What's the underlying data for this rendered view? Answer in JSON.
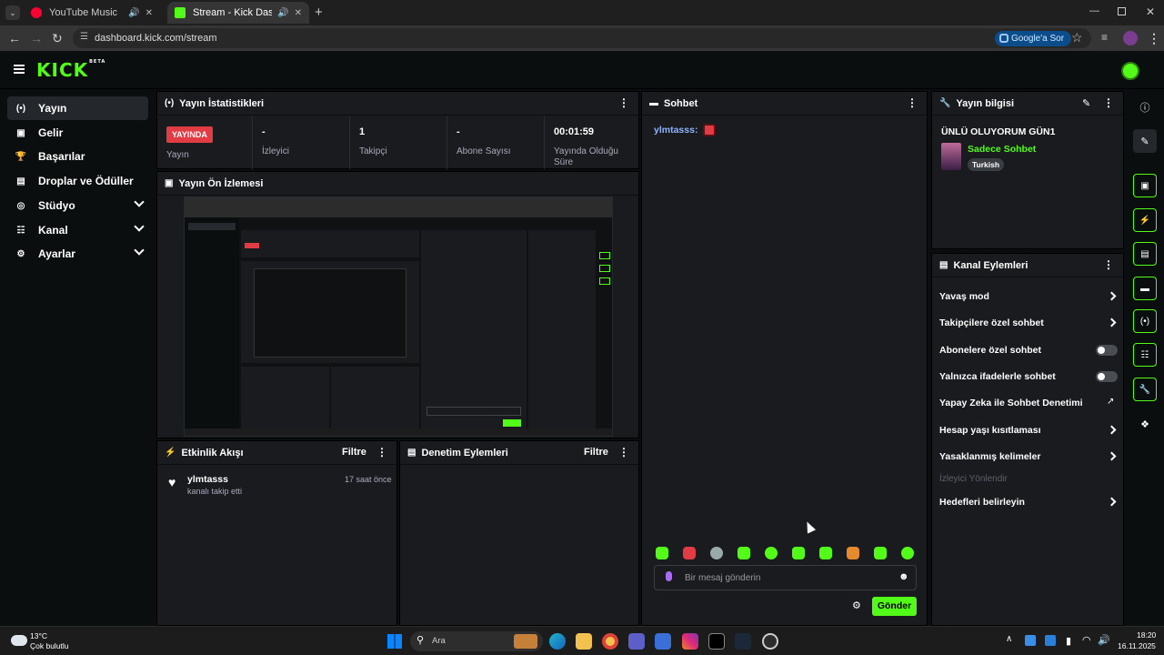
{
  "browser": {
    "tabs": [
      {
        "title": "YouTube Music",
        "active": false
      },
      {
        "title": "Stream - Kick Dashboard",
        "active": true
      }
    ],
    "new_tab_symbol": "+",
    "url": "dashboard.kick.com/stream",
    "google_sor": "Google'a Sor"
  },
  "app": {
    "logo": "KICK",
    "logo_badge": "BETA"
  },
  "sidebar": {
    "items": [
      {
        "label": "Yayın",
        "icon": "broadcast-icon",
        "active": true
      },
      {
        "label": "Gelir",
        "icon": "money-icon"
      },
      {
        "label": "Başarılar",
        "icon": "trophy-icon"
      },
      {
        "label": "Droplar ve Ödüller",
        "icon": "gift-icon"
      },
      {
        "label": "Stüdyo",
        "icon": "studio-icon",
        "expandable": true
      },
      {
        "label": "Kanal",
        "icon": "channel-icon",
        "expandable": true
      },
      {
        "label": "Ayarlar",
        "icon": "gear-icon",
        "expandable": true
      }
    ]
  },
  "stats": {
    "title": "Yayın İstatistikleri",
    "live_badge": "YAYINDA",
    "live_label": "Yayın",
    "cells": [
      {
        "value": "-",
        "label": "İzleyici"
      },
      {
        "value": "1",
        "label": "Takipçi"
      },
      {
        "value": "-",
        "label": "Abone Sayısı"
      },
      {
        "value": "00:01:59",
        "label": "Yayında Olduğu Süre"
      }
    ]
  },
  "preview": {
    "title": "Yayın Ön İzlemesi"
  },
  "activity": {
    "title": "Etkinlik Akışı",
    "filter": "Filtre",
    "events": [
      {
        "user": "ylmtasss",
        "time": "17 saat önce",
        "text": "kanalı takip etti"
      }
    ]
  },
  "moderation": {
    "title": "Denetim Eylemleri",
    "filter": "Filtre"
  },
  "chat": {
    "title": "Sohbet",
    "messages": [
      {
        "user": "ylmtasss:"
      }
    ],
    "input_placeholder": "Bir mesaj gönderin",
    "send_label": "Gönder"
  },
  "stream_info": {
    "title": "Yayın bilgisi",
    "stream_title": "ÜNLÜ OLUYORUM GÜN1",
    "category": "Sadece Sohbet",
    "tag": "Turkish"
  },
  "channel_actions": {
    "title": "Kanal Eylemleri",
    "rows": [
      {
        "label": "Yavaş mod",
        "control": "chevron"
      },
      {
        "label": "Takipçilere özel sohbet",
        "control": "chevron"
      },
      {
        "label": "Abonelere özel sohbet",
        "control": "toggle"
      },
      {
        "label": "Yalnızca ifadelerle sohbet",
        "control": "toggle"
      },
      {
        "label": "Yapay Zeka ile Sohbet Denetimi",
        "control": "external"
      },
      {
        "label": "Hesap yaşı kısıtlaması",
        "control": "chevron"
      },
      {
        "label": "Yasaklanmış kelimeler",
        "control": "chevron"
      },
      {
        "label": "İzleyici Yönlendir",
        "control": "disabled"
      },
      {
        "label": "Hedefleri belirleyin",
        "control": "chevron"
      }
    ]
  },
  "colors": {
    "brand": "#53fc18",
    "panel": "#191b1f",
    "live": "#e13b44"
  },
  "taskbar": {
    "weather_temp": "13°C",
    "weather_desc": "Çok bulutlu",
    "search": "Ara",
    "time": "18:20",
    "date": "16.11.2025"
  }
}
